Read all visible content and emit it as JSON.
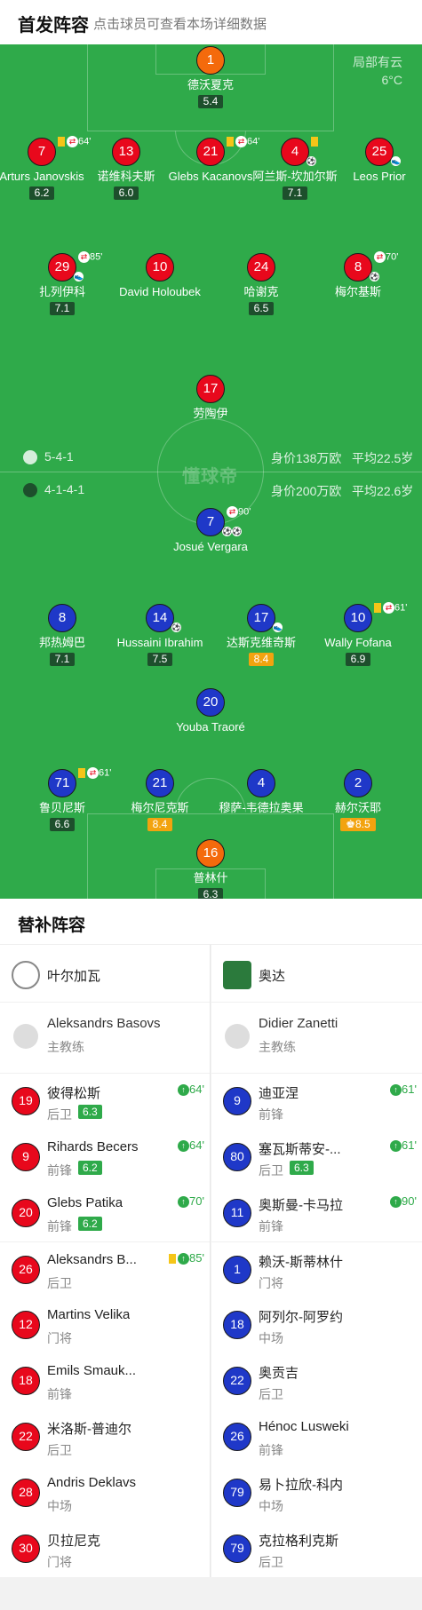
{
  "header": {
    "title": "首发阵容",
    "subtitle": "点击球员可查看本场详细数据"
  },
  "weather": {
    "desc": "局部有云",
    "temp": "6°C"
  },
  "watermark": "懂球帝",
  "teams_summary": {
    "home": {
      "formation": "5-4-1",
      "value": "身价138万欧",
      "age": "平均22.5岁"
    },
    "away": {
      "formation": "4-1-4-1",
      "value": "身价200万欧",
      "age": "平均22.6岁"
    }
  },
  "home_players": [
    {
      "num": "1",
      "name": "德沃夏克",
      "rating": "5.4",
      "color": "orange"
    },
    {
      "num": "7",
      "name": "Arturs Janovskis",
      "rating": "6.2",
      "card": true,
      "sub": "64'"
    },
    {
      "num": "13",
      "name": "诺维科夫斯",
      "rating": "6.0"
    },
    {
      "num": "21",
      "name": "Glebs Kacanovs",
      "rating": "",
      "card": true,
      "sub": "64'"
    },
    {
      "num": "4",
      "name": "阿兰斯-坎加尔斯",
      "rating": "7.1",
      "card": true,
      "goal": "1"
    },
    {
      "num": "25",
      "name": "Leos Prior",
      "rating": "",
      "assist": true
    },
    {
      "num": "29",
      "name": "扎列伊科",
      "rating": "7.1",
      "sub": "85'",
      "assist": true
    },
    {
      "num": "10",
      "name": "David Holoubek",
      "rating": ""
    },
    {
      "num": "24",
      "name": "哈谢克",
      "rating": "6.5"
    },
    {
      "num": "8",
      "name": "梅尔基斯",
      "rating": "",
      "sub": "70'",
      "goal": "1"
    },
    {
      "num": "17",
      "name": "劳陶伊",
      "rating": ""
    }
  ],
  "away_players": [
    {
      "num": "7",
      "name": "Josué Vergara",
      "rating": "",
      "sub": "90'",
      "goals": "2"
    },
    {
      "num": "8",
      "name": "邦热姆巴",
      "rating": "7.1"
    },
    {
      "num": "14",
      "name": "Hussaini Ibrahim",
      "rating": "7.5",
      "goal": "1"
    },
    {
      "num": "17",
      "name": "达斯克维奇斯",
      "rating": "8.4",
      "gold": true,
      "assist": true
    },
    {
      "num": "10",
      "name": "Wally Fofana",
      "rating": "6.9",
      "card": true,
      "sub": "61'"
    },
    {
      "num": "20",
      "name": "Youba Traoré",
      "rating": ""
    },
    {
      "num": "71",
      "name": "鲁贝尼斯",
      "rating": "6.6",
      "card": true,
      "sub": "61'"
    },
    {
      "num": "21",
      "name": "梅尔尼克斯",
      "rating": "8.4",
      "gold": true
    },
    {
      "num": "4",
      "name": "穆萨-韦德拉奥果",
      "rating": ""
    },
    {
      "num": "2",
      "name": "赫尔沃耶",
      "rating": "8.5",
      "gold": true,
      "crown": "♚"
    },
    {
      "num": "16",
      "name": "普林什",
      "rating": "6.3",
      "color": "orange"
    }
  ],
  "subs_header": "替补阵容",
  "home_bench": {
    "team": "叶尔加瓦",
    "coach": {
      "name": "Aleksandrs Basovs",
      "role": "主教练"
    },
    "subs": [
      {
        "num": "19",
        "name": "彼得松斯",
        "pos": "后卫",
        "rating": "6.3",
        "in": "64'"
      },
      {
        "num": "9",
        "name": "Rihards Becers",
        "pos": "前锋",
        "rating": "6.2",
        "in": "64'"
      },
      {
        "num": "20",
        "name": "Glebs Patika",
        "pos": "前锋",
        "rating": "6.2",
        "in": "70'"
      },
      {
        "num": "26",
        "name": "Aleksandrs B...",
        "pos": "后卫",
        "rating": "",
        "in": "85'",
        "card": true
      },
      {
        "num": "12",
        "name": "Martins Velika",
        "pos": "门将",
        "rating": ""
      },
      {
        "num": "18",
        "name": "Emils Smauk...",
        "pos": "前锋",
        "rating": ""
      },
      {
        "num": "22",
        "name": "米洛斯-普迪尔",
        "pos": "后卫",
        "rating": ""
      },
      {
        "num": "28",
        "name": "Andris Deklavs",
        "pos": "中场",
        "rating": ""
      },
      {
        "num": "30",
        "name": "贝拉尼克",
        "pos": "门将",
        "rating": ""
      }
    ]
  },
  "away_bench": {
    "team": "奥达",
    "coach": {
      "name": "Didier Zanetti",
      "role": "主教练"
    },
    "subs": [
      {
        "num": "9",
        "name": "迪亚涅",
        "pos": "前锋",
        "rating": "",
        "in": "61'"
      },
      {
        "num": "80",
        "name": "塞瓦斯蒂安-...",
        "pos": "后卫",
        "rating": "6.3",
        "in": "61'"
      },
      {
        "num": "11",
        "name": "奥斯曼-卡马拉",
        "pos": "前锋",
        "rating": "",
        "in": "90'"
      },
      {
        "num": "1",
        "name": "赖沃-斯蒂林什",
        "pos": "门将",
        "rating": ""
      },
      {
        "num": "18",
        "name": "阿列尔-阿罗约",
        "pos": "中场",
        "rating": ""
      },
      {
        "num": "22",
        "name": "奥贡吉",
        "pos": "后卫",
        "rating": ""
      },
      {
        "num": "26",
        "name": "Hénoc Lusweki",
        "pos": "前锋",
        "rating": ""
      },
      {
        "num": "79",
        "name": "易卜拉欣-科内",
        "pos": "中场",
        "rating": ""
      },
      {
        "num": "79",
        "name": "克拉格利克斯",
        "pos": "后卫",
        "rating": ""
      }
    ]
  },
  "colors": {
    "pitch": "#2faa4a",
    "home": "#e8081c",
    "away": "#1f38c8",
    "keeper": "#f46a0c",
    "gold": "#f2a30f"
  }
}
